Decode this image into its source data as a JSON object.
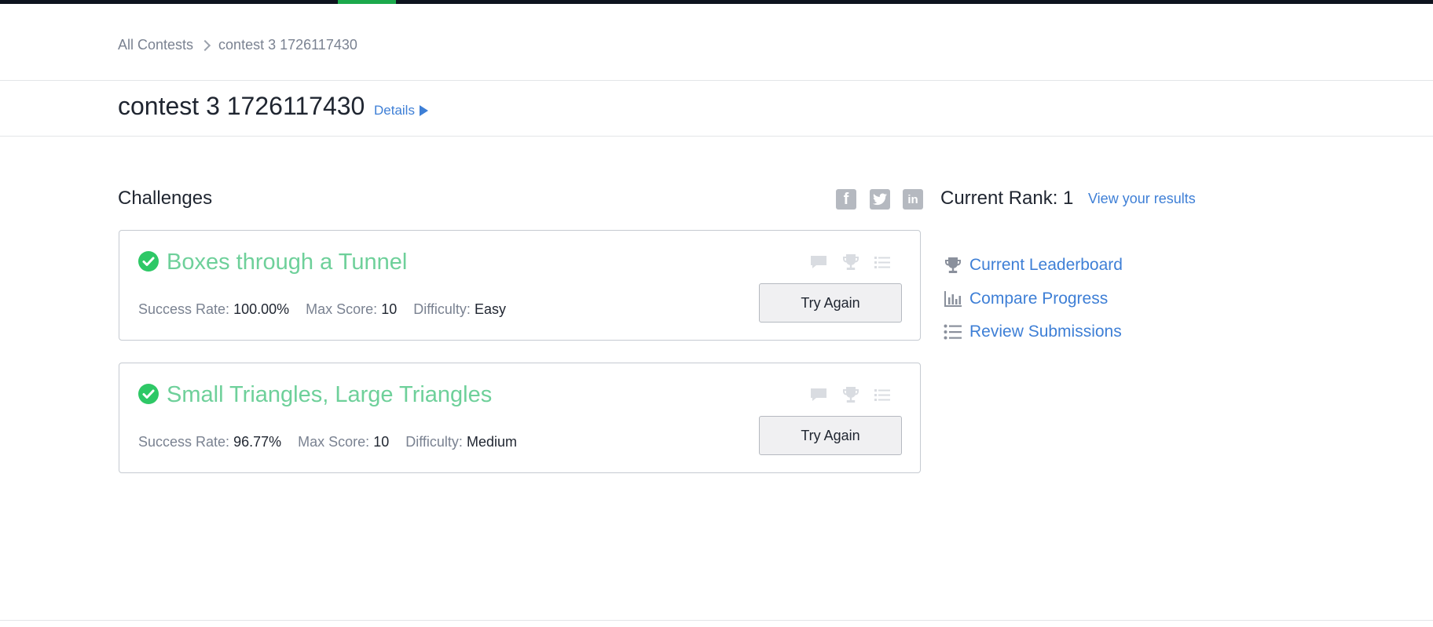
{
  "breadcrumb": {
    "root": "All Contests",
    "current": "contest 3 1726117430"
  },
  "header": {
    "title": "contest 3 1726117430",
    "details_label": "Details"
  },
  "challenges": {
    "section_title": "Challenges",
    "labels": {
      "success_rate": "Success Rate:",
      "max_score": "Max Score:",
      "difficulty": "Difficulty:"
    },
    "items": [
      {
        "name": "Boxes through a Tunnel",
        "success_rate": "100.00%",
        "max_score": "10",
        "difficulty": "Easy",
        "button_label": "Try Again",
        "solved": true
      },
      {
        "name": "Small Triangles, Large Triangles",
        "success_rate": "96.77%",
        "max_score": "10",
        "difficulty": "Medium",
        "button_label": "Try Again",
        "solved": true
      }
    ]
  },
  "social": {
    "icons": [
      "facebook-icon",
      "twitter-icon",
      "linkedin-icon"
    ],
    "facebook_glyph": "f",
    "linkedin_glyph": "in"
  },
  "sidebar": {
    "rank_text": "Current Rank: 1",
    "results_link": "View your results",
    "links": [
      {
        "label": "Current Leaderboard",
        "icon": "trophy-icon"
      },
      {
        "label": "Compare Progress",
        "icon": "bar-chart-icon"
      },
      {
        "label": "Review Submissions",
        "icon": "list-icon"
      }
    ]
  },
  "colors": {
    "accent_green": "#1ba94c",
    "solved_green": "#2ec866",
    "challenge_title": "#6ed09a",
    "link_blue": "#3e7fd6",
    "muted_icon": "#b5b9c0"
  }
}
